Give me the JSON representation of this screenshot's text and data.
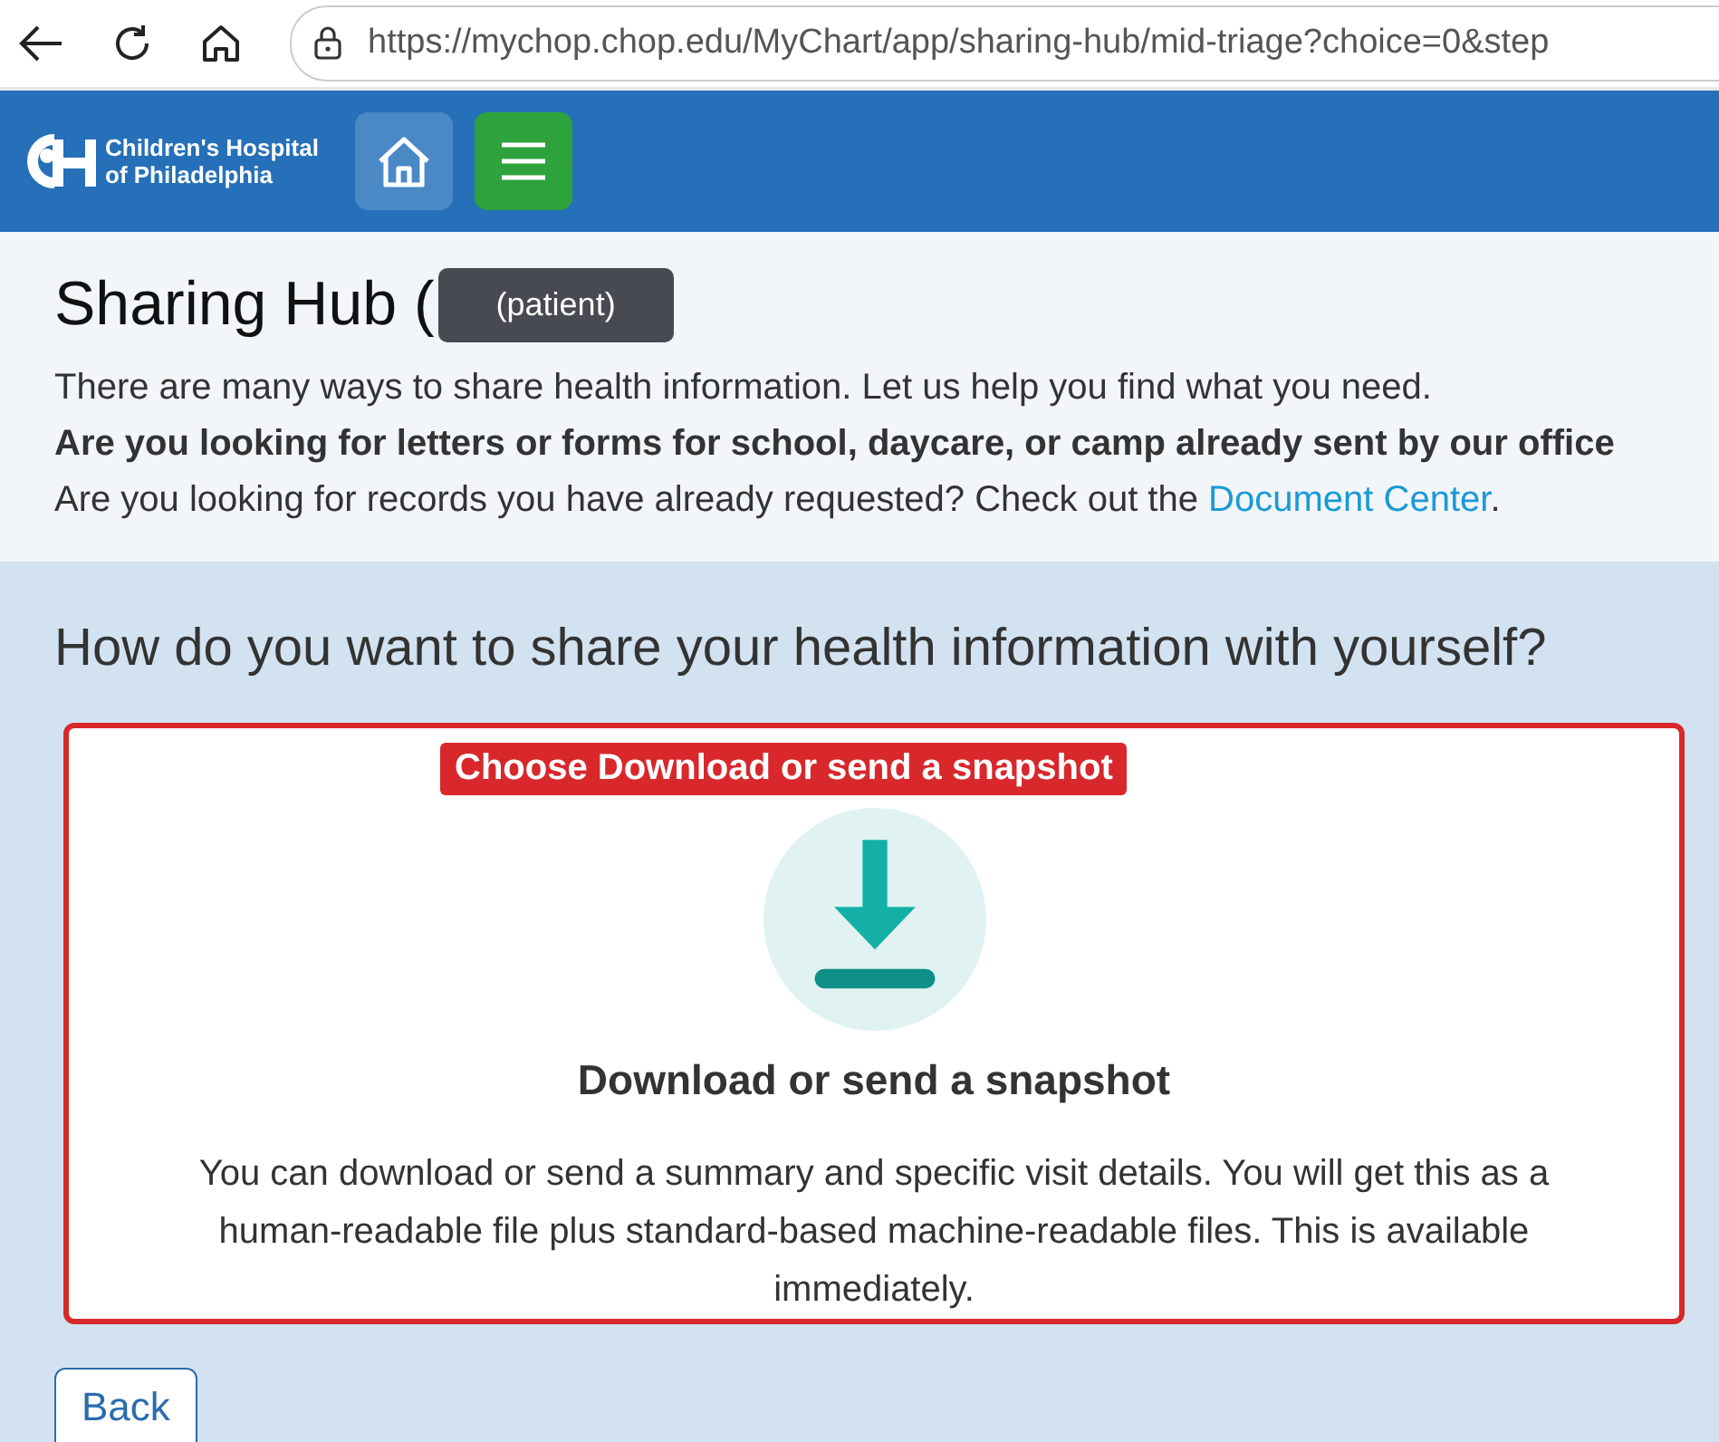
{
  "browser": {
    "url": "https://mychop.chop.edu/MyChart/app/sharing-hub/mid-triage?choice=0&step"
  },
  "header": {
    "logo_line_1": "Children's Hospital",
    "logo_line_2": "of Philadelphia"
  },
  "page": {
    "title": "Sharing Hub (",
    "patient_label": "(patient)",
    "intro": [
      "There are many ways to share health information. Let us help you find what you need.",
      "**Are you looking for letters or forms for school, daycare, or camp already sent by our office**"
    ],
    "records_text": "Are you looking for records you have already requested? Check out the",
    "records_link": "Document Center",
    "records_end": "."
  },
  "question": "How do you want to share your health information with yourself?",
  "annotation": "Choose Download or send a snapshot",
  "option": {
    "title": "Download or send a snapshot",
    "description": "You can download or send a summary and specific visit details. You will get this as a human-readable file plus standard-based machine-readable files. This is available immediately."
  },
  "back_button": "Back"
}
